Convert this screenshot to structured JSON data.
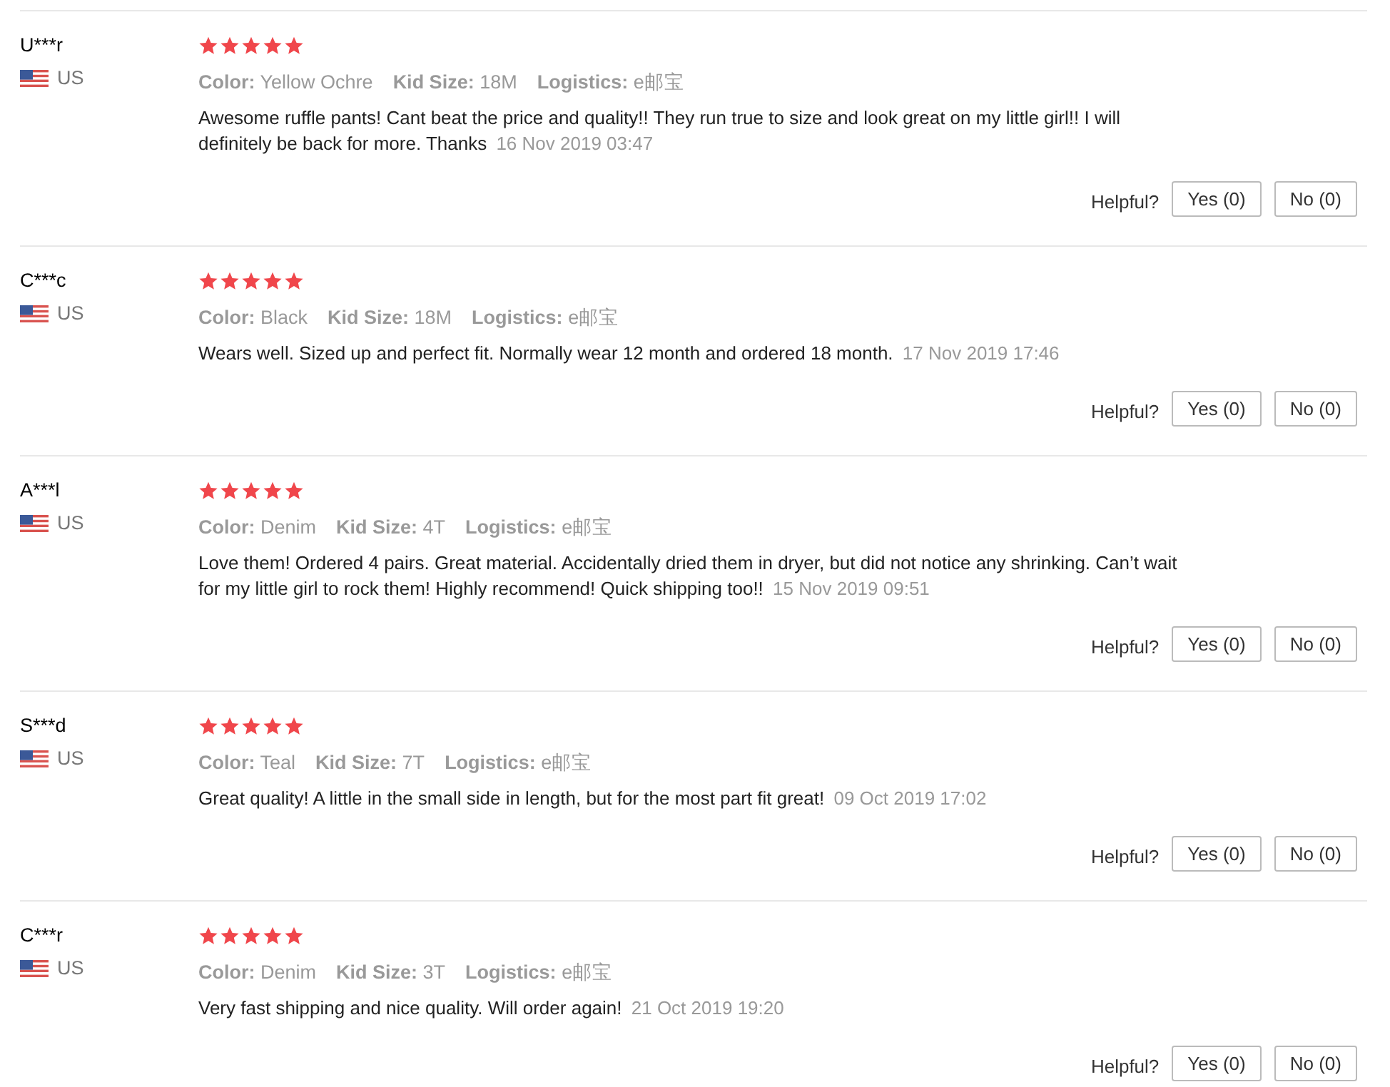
{
  "reviews": [
    {
      "name": "U***r",
      "country": "US",
      "stars": 5,
      "attributes": [
        {
          "label": "Color:",
          "value": "Yellow Ochre"
        },
        {
          "label": "Kid Size:",
          "value": "18M"
        },
        {
          "label": "Logistics:",
          "value": "e邮宝"
        }
      ],
      "text": "Awesome ruffle pants! Cant beat the price and quality!! They run true to size and look great on my little girl!! I will definitely be back for more. Thanks",
      "date": "16 Nov 2019 03:47",
      "helpful_label": "Helpful?",
      "yes_button": "Yes (0)",
      "no_button": "No (0)"
    },
    {
      "name": "C***c",
      "country": "US",
      "stars": 5,
      "attributes": [
        {
          "label": "Color:",
          "value": "Black"
        },
        {
          "label": "Kid Size:",
          "value": "18M"
        },
        {
          "label": "Logistics:",
          "value": "e邮宝"
        }
      ],
      "text": "Wears well. Sized up and perfect fit. Normally wear 12 month and ordered 18 month.",
      "date": "17 Nov 2019 17:46",
      "helpful_label": "Helpful?",
      "yes_button": "Yes (0)",
      "no_button": "No (0)"
    },
    {
      "name": "A***l",
      "country": "US",
      "stars": 5,
      "attributes": [
        {
          "label": "Color:",
          "value": "Denim"
        },
        {
          "label": "Kid Size:",
          "value": "4T"
        },
        {
          "label": "Logistics:",
          "value": "e邮宝"
        }
      ],
      "text": "Love them! Ordered 4 pairs. Great material. Accidentally dried them in dryer, but did not notice any shrinking. Can’t wait for my little girl to rock them! Highly recommend! Quick shipping too!!",
      "date": "15 Nov 2019 09:51",
      "helpful_label": "Helpful?",
      "yes_button": "Yes (0)",
      "no_button": "No (0)"
    },
    {
      "name": "S***d",
      "country": "US",
      "stars": 5,
      "attributes": [
        {
          "label": "Color:",
          "value": "Teal"
        },
        {
          "label": "Kid Size:",
          "value": "7T"
        },
        {
          "label": "Logistics:",
          "value": "e邮宝"
        }
      ],
      "text": "Great quality! A little in the small side in length, but for the most part fit great!",
      "date": "09 Oct 2019 17:02",
      "helpful_label": "Helpful?",
      "yes_button": "Yes (0)",
      "no_button": "No (0)"
    },
    {
      "name": "C***r",
      "country": "US",
      "stars": 5,
      "attributes": [
        {
          "label": "Color:",
          "value": "Denim"
        },
        {
          "label": "Kid Size:",
          "value": "3T"
        },
        {
          "label": "Logistics:",
          "value": "e邮宝"
        }
      ],
      "text": "Very fast shipping and nice quality. Will order again!",
      "date": "21 Oct 2019 19:20",
      "helpful_label": "Helpful?",
      "yes_button": "Yes (0)",
      "no_button": "No (0)"
    }
  ]
}
